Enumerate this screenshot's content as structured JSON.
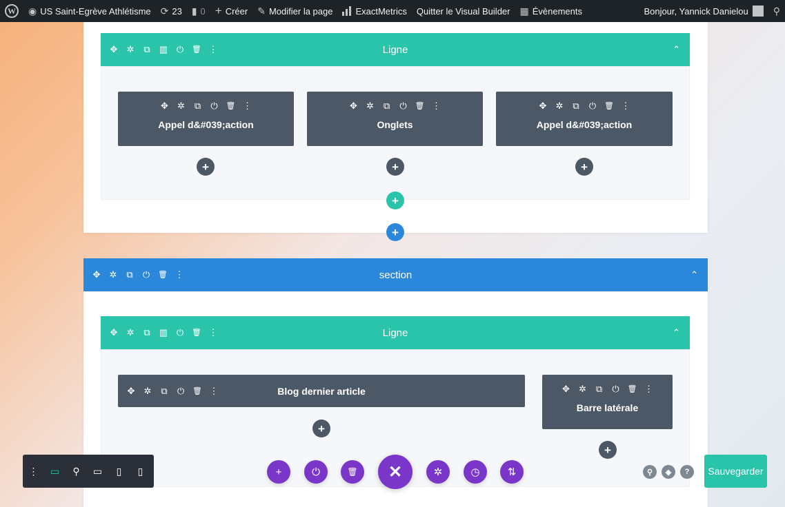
{
  "adminbar": {
    "site_name": "US Saint-Egrève Athlétisme",
    "updates_count": "23",
    "comments_count": "0",
    "create_label": "Créer",
    "edit_page_label": "Modifier la page",
    "exactmetrics_label": "ExactMetrics",
    "quit_builder_label": "Quitter le Visual Builder",
    "events_label": "Évènements",
    "greeting": "Bonjour, Yannick Danielou"
  },
  "row1": {
    "title": "Ligne",
    "modules": [
      {
        "title": "Appel d&#039;action"
      },
      {
        "title": "Onglets"
      },
      {
        "title": "Appel d&#039;action"
      }
    ]
  },
  "section2": {
    "title": "section"
  },
  "row2": {
    "title": "Ligne",
    "modules": [
      {
        "title": "Blog dernier article"
      },
      {
        "title": "Barre latérale"
      }
    ]
  },
  "icons": {
    "move": "✥",
    "settings": "✲",
    "duplicate": "⧉",
    "columns": "▥",
    "power": "⏻",
    "trash": "🗑",
    "more": "⋮",
    "plus": "+",
    "caret": "⌃"
  },
  "footer": {
    "save_label": "Sauvegarder"
  },
  "colors": {
    "row_green": "#29c4a9",
    "section_blue": "#2b87da",
    "module_dark": "#4c5866",
    "builder_purple": "#7a35c9"
  }
}
